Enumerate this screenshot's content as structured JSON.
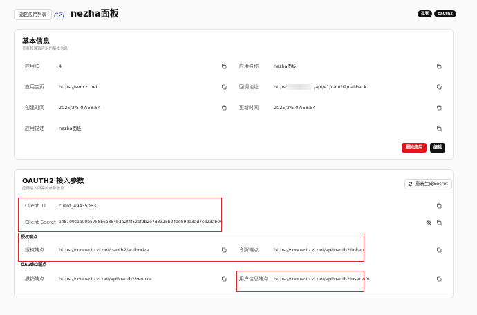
{
  "header": {
    "back_label": "返回应用列表",
    "logo_text": "CZL",
    "title": "nezha面板",
    "badges": [
      "私有",
      "oauth2"
    ]
  },
  "basic": {
    "title": "基本信息",
    "subtitle": "查看和编辑应用的基本信息",
    "fields": {
      "app_id": {
        "label": "应用ID",
        "value": "4"
      },
      "app_name": {
        "label": "应用名称",
        "value": "nezha面板"
      },
      "homepage": {
        "label": "应用主页",
        "value": "https://svr.czl.net"
      },
      "callback_prefix": {
        "label": "回调地址",
        "value": "https://"
      },
      "callback_suffix": {
        "value": "/api/v1/oauth2/callback"
      },
      "created": {
        "label": "创建时间",
        "value": "2025/3/5 07:58:54"
      },
      "updated": {
        "label": "更新时间",
        "value": "2025/3/5 07:58:54"
      },
      "desc": {
        "label": "应用描述",
        "value": "nezha面板"
      }
    },
    "delete_label": "删除应用",
    "edit_label": "编辑"
  },
  "oauth": {
    "title": "OAUTH2 接入参数",
    "subtitle": "应用接入所需的参数信息",
    "regen_label": "重新生成Secret",
    "client_id": {
      "label": "Client ID",
      "value": "client_49435063"
    },
    "client_secret": {
      "label": "Client Secret",
      "value": "a48109c1a00b5758b6a354b3b2f4f52ef9b2e7d3325b24ad89de3ad7cd23ab06"
    },
    "auth_section": "授权端点",
    "authorize": {
      "label": "授权端点",
      "value": "https://connect.czl.net/oauth2/authorize"
    },
    "token": {
      "label": "令牌端点",
      "value": "https://connect.czl.net/api/oauth2/token"
    },
    "oauth2_section": "OAuth2端点",
    "revoke": {
      "label": "撤销端点",
      "value": "https://connect.czl.net/api/oauth2/revoke"
    },
    "userinfo": {
      "label": "用户信息端点",
      "value": "https://connect.czl.net/api/oauth2/userinfo"
    }
  },
  "colors": {
    "danger": "#e0121b",
    "primary": "#111111",
    "highlight": "#e0242c"
  }
}
